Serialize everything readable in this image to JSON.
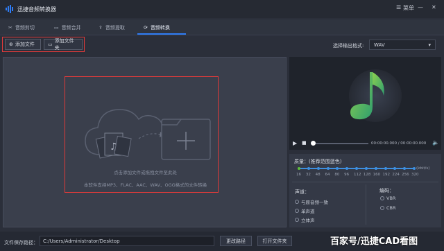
{
  "app": {
    "title": "迅捷音频转换器",
    "menu_label": "菜单"
  },
  "tabs": [
    {
      "label": "音频剪切",
      "icon": "scissors-icon"
    },
    {
      "label": "音频合并",
      "icon": "merge-icon"
    },
    {
      "label": "音频提取",
      "icon": "extract-icon"
    },
    {
      "label": "音频转换",
      "icon": "convert-icon",
      "active": true
    }
  ],
  "toolbar": {
    "add_file_label": "添加文件",
    "add_folder_label": "添加文件夹",
    "output_format_label": "选择输出格式:",
    "output_format_value": "WAV"
  },
  "drop_area": {
    "hint": "点击添加文件或拖拽文件至此处",
    "support": "本软件支持MP3、FLAC、AAC、WAV、OGG格式的文件转换"
  },
  "player": {
    "time": "00:00:00.000 / 00:00:00.000",
    "progress": 0.0
  },
  "settings": {
    "quality_label": "质量：(推荐范围蓝色)",
    "bitrate_unit": "(kbit/s)",
    "bitrate_ticks": [
      "16",
      "32",
      "48",
      "64",
      "80",
      "96",
      "112",
      "128",
      "160",
      "192",
      "224",
      "256",
      "320"
    ],
    "selected_bitrate": "16",
    "channel_label": "声道：",
    "channel_options": [
      "与原音频一致",
      "单声道",
      "立体声"
    ],
    "encoding_label": "编码：",
    "encoding_options": [
      "VBR",
      "CBR"
    ]
  },
  "footer": {
    "save_path_label": "文件保存路径：",
    "save_path_value": "C:/Users/Administrator/Desktop",
    "change_path_label": "更改路径",
    "open_folder_label": "打开文件夹"
  },
  "watermark": "百家号/迅捷CAD看图",
  "colors": {
    "accent": "#2f7df6",
    "highlight": "#e23a3a",
    "music_green": "#5fbf3a"
  }
}
